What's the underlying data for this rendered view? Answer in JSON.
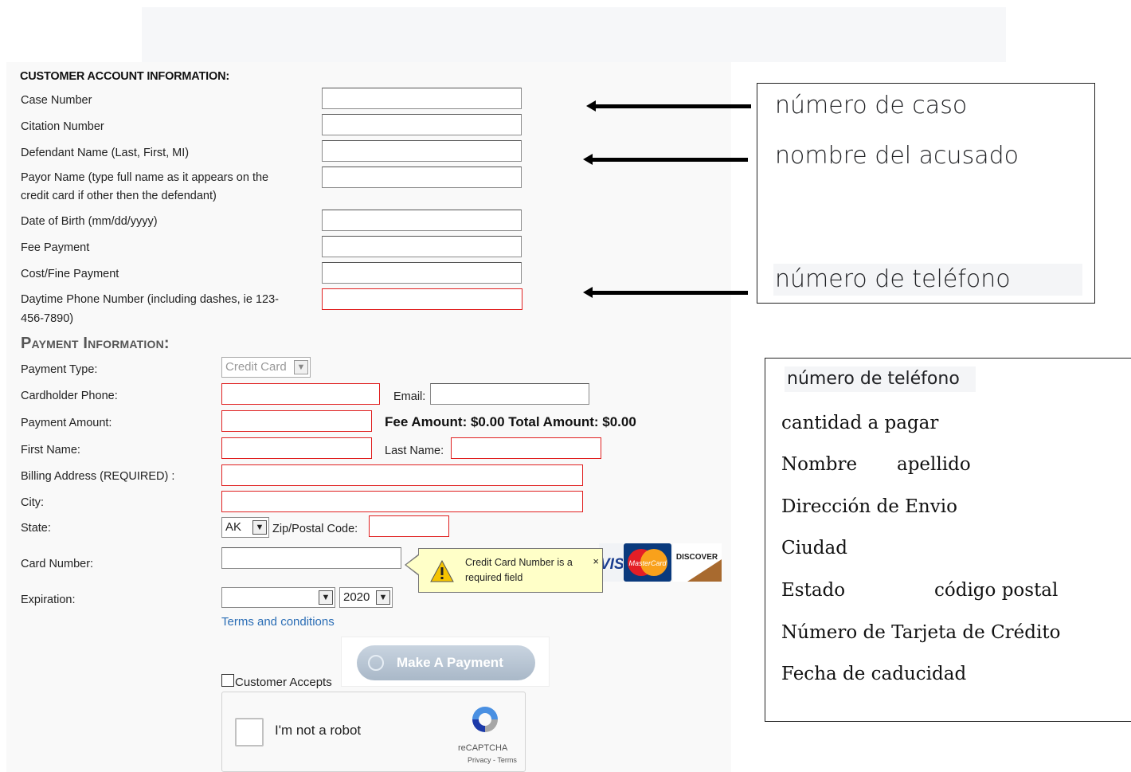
{
  "account_section": {
    "heading": "CUSTOMER ACCOUNT INFORMATION:",
    "fields": [
      {
        "label": "Case Number",
        "value": ""
      },
      {
        "label": "Citation Number",
        "value": ""
      },
      {
        "label": "Defendant Name (Last, First, MI)",
        "value": ""
      },
      {
        "label_line1": "Payor Name (type full name as it appears on the",
        "label_line2": "credit card if other then the defendant)",
        "value": ""
      },
      {
        "label": "Date of Birth (mm/dd/yyyy)",
        "value": ""
      },
      {
        "label": "Fee Payment",
        "value": ""
      },
      {
        "label": "Cost/Fine Payment",
        "value": ""
      },
      {
        "label_line1": "Daytime Phone Number (including dashes, ie 123-",
        "label_line2": "456-7890)",
        "value": ""
      }
    ]
  },
  "payment_section": {
    "heading": "Payment Information:",
    "payment_type_label": "Payment Type:",
    "payment_type_value": "Credit Card",
    "cardholder_phone_label": "Cardholder Phone:",
    "email_label": "Email:",
    "payment_amount_label": "Payment Amount:",
    "fee_amount_text": "Fee Amount: $0.00 Total Amount: $0.00",
    "first_name_label": "First Name:",
    "last_name_label": "Last Name:",
    "billing_address_label": "Billing Address (REQUIRED) :",
    "city_label": "City:",
    "state_label": "State:",
    "state_value": "AK",
    "zip_label": "Zip/Postal Code:",
    "card_number_label": "Card Number:",
    "expiration_label": "Expiration:",
    "expiration_month": "",
    "expiration_year": "2020",
    "terms_link": "Terms and conditions",
    "pay_button": "Make A Payment",
    "customer_accepts": "Customer Accepts",
    "tooltip": {
      "message": "Credit Card Number is a required field",
      "close": "×"
    },
    "cards": {
      "visa": "VISA",
      "mastercard": "MasterCard",
      "discover": "DISCOVER"
    }
  },
  "captcha": {
    "label": "I'm not a robot",
    "brand": "reCAPTCHA",
    "links": "Privacy - Terms"
  },
  "annotations_top": {
    "case_number": "número de caso",
    "defendant_name": "nombre del acusado",
    "phone_number": "número de teléfono"
  },
  "annotations_payment": {
    "phone": "número de teléfono",
    "amount": "cantidad a pagar",
    "first_name": "Nombre",
    "last_name": "apellido",
    "address": "Dirección de Envio",
    "city": "Ciudad",
    "state": "Estado",
    "zip": "código postal",
    "card_number": "Número de Tarjeta de Crédito",
    "expiration": "Fecha de caducidad"
  },
  "colors": {
    "required_border": "#e02020",
    "link": "#2a6db5",
    "tooltip_bg": "#ffffc8"
  }
}
